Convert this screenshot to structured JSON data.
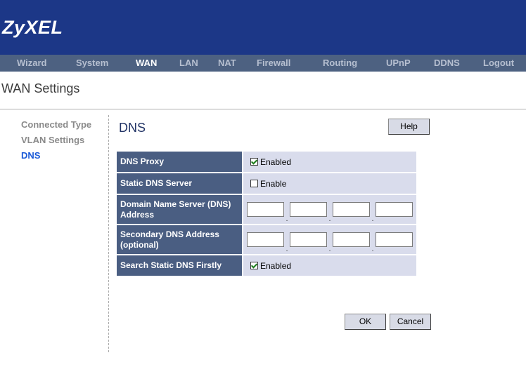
{
  "header": {
    "logo": "ZyXEL"
  },
  "nav": [
    "Wizard",
    "System",
    "WAN",
    "LAN",
    "NAT",
    "Firewall",
    "Routing",
    "UPnP",
    "DDNS",
    "Logout"
  ],
  "page_title": "WAN Settings",
  "sidebar": [
    "Connected Type",
    "VLAN Settings",
    "DNS"
  ],
  "section_title": "DNS",
  "help_label": "Help",
  "rows": {
    "dns_proxy": {
      "label": "DNS Proxy",
      "option": "Enabled",
      "checked": true
    },
    "static_dns": {
      "label": "Static DNS Server",
      "option": "Enable",
      "checked": false
    },
    "primary_dns": {
      "label": "Domain Name Server (DNS) Address",
      "octets": [
        "",
        "",
        "",
        ""
      ]
    },
    "secondary_dns": {
      "label": "Secondary DNS Address (optional)",
      "octets": [
        "",
        "",
        "",
        ""
      ]
    },
    "search_static": {
      "label": "Search Static DNS Firstly",
      "option": "Enabled",
      "checked": true
    }
  },
  "buttons": {
    "ok": "OK",
    "cancel": "Cancel"
  },
  "colors": {
    "header": "#1c3787",
    "nav": "#4d6181",
    "label_cell": "#4a5e82",
    "value_cell": "#d9dcec",
    "active_link": "#1a5ad8"
  }
}
